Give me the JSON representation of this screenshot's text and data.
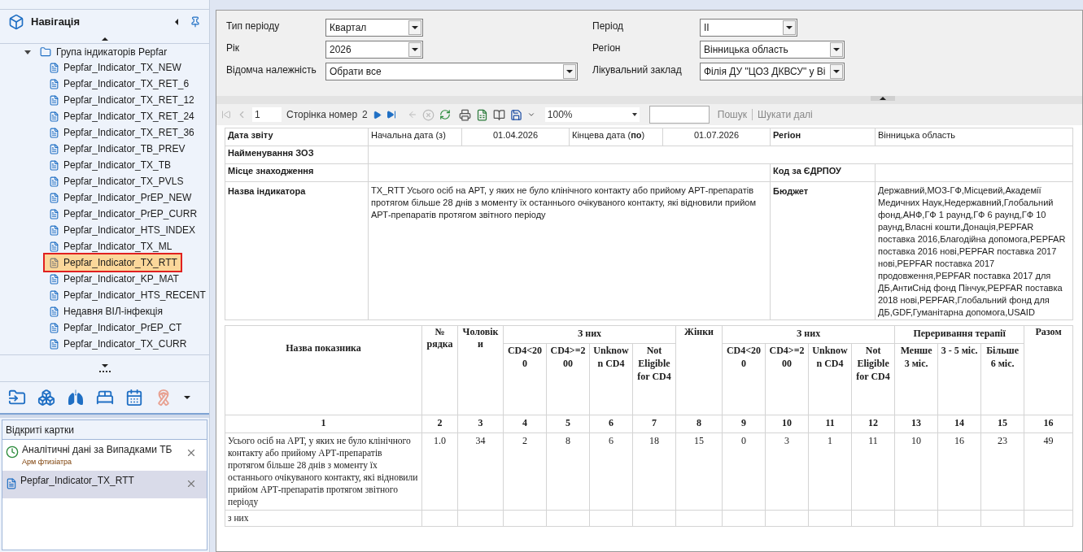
{
  "navigation": {
    "title": "Навігація",
    "group": {
      "label": "Група індикаторів Pepfar",
      "expanded": true,
      "items": [
        {
          "label": "Pepfar_Indicator_TX_NEW",
          "selected": false
        },
        {
          "label": "Pepfar_Indicator_TX_RET_6",
          "selected": false
        },
        {
          "label": "Pepfar_Indicator_TX_RET_12",
          "selected": false
        },
        {
          "label": "Pepfar_Indicator_TX_RET_24",
          "selected": false
        },
        {
          "label": "Pepfar_Indicator_TX_RET_36",
          "selected": false
        },
        {
          "label": "Pepfar_Indicator_TB_PREV",
          "selected": false
        },
        {
          "label": "Pepfar_Indicator_TX_TB",
          "selected": false
        },
        {
          "label": "Pepfar_Indicator_TX_PVLS",
          "selected": false
        },
        {
          "label": "Pepfar_Indicator_PrEP_NEW",
          "selected": false
        },
        {
          "label": "Pepfar_Indicator_PrEP_CURR",
          "selected": false
        },
        {
          "label": "Pepfar_Indicator_HTS_INDEX",
          "selected": false
        },
        {
          "label": "Pepfar_Indicator_TX_ML",
          "selected": false
        },
        {
          "label": "Pepfar_Indicator_TX_RTT",
          "selected": true
        },
        {
          "label": "Pepfar_Indicator_KP_MAT",
          "selected": false
        },
        {
          "label": "Pepfar_Indicator_HTS_RECENT",
          "selected": false
        },
        {
          "label": "Недавня ВІЛ-інфекція",
          "selected": false
        },
        {
          "label": "Pepfar_Indicator_PrEP_CT",
          "selected": false
        },
        {
          "label": "Pepfar_Indicator_TX_CURR",
          "selected": false
        }
      ]
    }
  },
  "open_cards": {
    "title": "Відкриті картки",
    "items": [
      {
        "kind": "analytics",
        "title": "Аналітичні дані за Випадками ТБ",
        "subtitle": "Арм фтизіатра",
        "selected": false
      },
      {
        "kind": "document",
        "title": "Pepfar_Indicator_TX_RTT",
        "selected": true
      }
    ]
  },
  "filters": {
    "left": [
      {
        "label": "Тип періоду",
        "value": "Квартал",
        "kind": "short"
      },
      {
        "label": "Рік",
        "value": "2026",
        "kind": "short"
      },
      {
        "label": "Відомча належність",
        "value": "Обрати все",
        "kind": "wide"
      }
    ],
    "right": [
      {
        "label": "Період",
        "value": "II",
        "kind": "short"
      },
      {
        "label": "Регіон",
        "value": "Вінницька область",
        "kind": "wide"
      },
      {
        "label": "Лікувальний заклад",
        "value": "Філія ДУ \"ЦОЗ ДКВСУ\" у Ві",
        "kind": "wide"
      }
    ]
  },
  "report_toolbar": {
    "page": "1",
    "page_label": "Сторінка номер",
    "page_total": "2",
    "zoom": "100%",
    "search": "Пошук",
    "find_next": "Шукати далі"
  },
  "report_header": {
    "report_date_label": "Дата звіту",
    "start_label": "Начальна дата (з)",
    "start_date": "01.04.2026",
    "end_label": "Кінцева дата (**по**)",
    "end_date": "01.07.2026",
    "region_label": "Регіон",
    "region": "Вінницька область",
    "facility_label": "Найменування ЗОЗ",
    "location_label": "Місце знаходження",
    "edrpou_label": "Код за ЄДРПОУ",
    "indicator_label": "Назва індикатора",
    "indicator": "TX_RTT Усього осіб на АРТ, у яких не було клінічного контакту або прийому АРТ-препаратів протягом більше 28 днів з моменту їх останнього очікуваного контакту, які відновили прийом АРТ-препаратів протягом звітного періоду",
    "budget_label": "Бюджет",
    "budget": "Державний,МОЗ-ГФ,Місцевий,Академії Медичних Наук,Недержавний,Глобальний фонд,АНФ,ГФ 1 раунд,ГФ 6 раунд,ГФ 10 раунд,Власні кошти,Донація,PEPFAR поставка 2016,Благодійна допомога,PEPFAR поставка 2016 нові,PEPFAR поставка 2017 нові,PEPFAR поставка 2017 продовження,PEPFAR поставка 2017 для ДБ,АнтиСнід фонд Пінчук,PEPFAR поставка 2018 нові,PEPFAR,Глобальний фонд для ДБ,GDF,Гуманітарна допомога,USAID"
  },
  "table": {
    "columns": [
      {
        "label": "Назва показника"
      },
      {
        "label": "№ рядка"
      },
      {
        "label": "Чоловіки"
      },
      {
        "label": "З них",
        "children": [
          "CD4<200",
          "CD4>=200",
          "Unknown CD4",
          "Not Eligible for CD4"
        ]
      },
      {
        "label": "Жінки"
      },
      {
        "label": "З них",
        "children": [
          "CD4<200",
          "CD4>=200",
          "Unknown CD4",
          "Not Eligible for CD4"
        ]
      },
      {
        "label": "Переривання терапії",
        "children": [
          "Менше 3 міс.",
          "3 - 5 міс.",
          "Більше 6 міс."
        ]
      },
      {
        "label": "Разом"
      }
    ],
    "column_numbers": [
      "1",
      "2",
      "3",
      "4",
      "5",
      "6",
      "7",
      "8",
      "9",
      "10",
      "11",
      "12",
      "13",
      "14",
      "15",
      "16"
    ],
    "rows": [
      {
        "label": "Усього осіб на АРТ, у яких не було клінічного контакту або прийому АРТ-препаратів протягом більше 28 днів з моменту їх останнього очікуваного контакту, які відновили прийом АРТ-препаратів протягом звітного періоду",
        "values": [
          "1.0",
          "34",
          "2",
          "8",
          "6",
          "18",
          "15",
          "0",
          "3",
          "1",
          "11",
          "10",
          "16",
          "23",
          "49"
        ]
      },
      {
        "label": "з них",
        "values": []
      }
    ]
  }
}
